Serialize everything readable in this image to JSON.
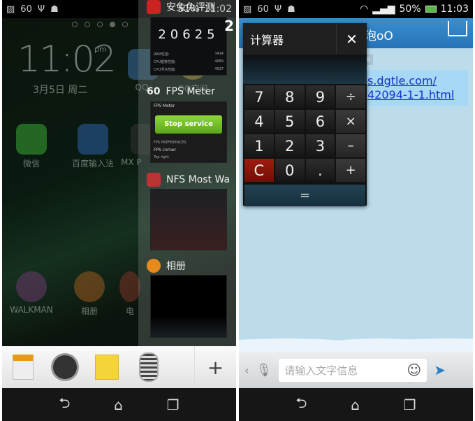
{
  "left": {
    "status": {
      "fps": "60",
      "right": "51%",
      "time": "11:02"
    },
    "clock": {
      "time": "11:02",
      "ampm": "pm",
      "date": "3月5日 周二"
    },
    "apps_row1": [
      "微信",
      "百度输入法",
      "MX P"
    ],
    "apps_top": [
      "QQ",
      "QQ空间"
    ],
    "apps_row2": [
      "WALKMAN",
      "相册",
      "电"
    ],
    "recent": [
      {
        "title": "安兔兔评测",
        "score": "20625",
        "rows": [
          [
            "RAM性能:",
            "3414"
          ],
          [
            "CPU整数性能:",
            "4689"
          ],
          [
            "CPU浮点性能:",
            "4027"
          ]
        ]
      },
      {
        "title": "FPS Meter",
        "badge": "60",
        "thumb_title": "FPS Meter",
        "button": "Stop service",
        "section": "FPS PREFERENCES",
        "pref": "FPS corner",
        "pref_sub": "Top right"
      },
      {
        "title": "NFS Most Wa"
      },
      {
        "title": "相册"
      }
    ],
    "overlay_digit": "2",
    "dock": [
      "calculator-icon",
      "timer-icon",
      "notes-icon",
      "voice-recorder-icon"
    ],
    "dock_add": "+"
  },
  "right": {
    "status": {
      "fps": "60",
      "battery": "50%",
      "time": "11:03"
    },
    "chat_title": "泡oO",
    "timestamp": "6",
    "message": [
      "s.dgtle.com/",
      "42094-1-1.html"
    ],
    "calculator": {
      "title": "计算器",
      "close": "✕",
      "keys": [
        "7",
        "8",
        "9",
        "÷",
        "4",
        "5",
        "6",
        "×",
        "1",
        "2",
        "3",
        "–",
        "C",
        "0",
        ".",
        "+"
      ],
      "equals": "="
    },
    "input_placeholder": "请输入文字信息"
  },
  "nav": {
    "back": "⮌",
    "home": "⌂",
    "recents": "❐"
  },
  "colors": {
    "accent": "#2a7fc4",
    "chat_bg": "#bcdcec",
    "clear_key": "#a21b0e",
    "stop_button": "#7cc62e"
  }
}
